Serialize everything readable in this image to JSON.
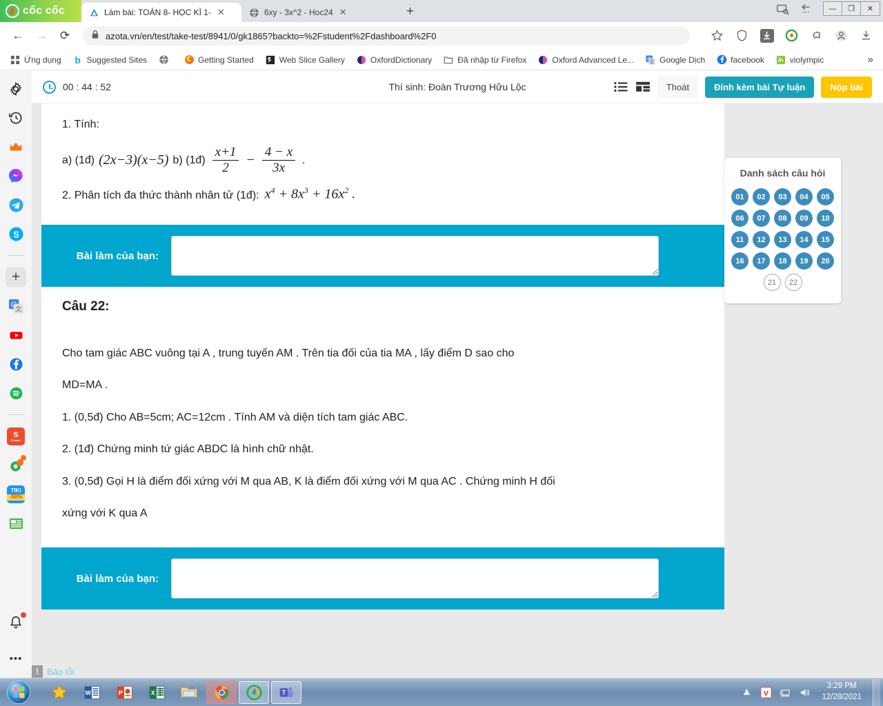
{
  "browser": {
    "brand": "cốc cốc",
    "tabs": [
      {
        "title": "Làm bài: TOÁN 8- HỌC KÌ 1-",
        "active": true,
        "favicon": "azota-triangle-icon"
      },
      {
        "title": "6xy - 3x^2 - Hoc24",
        "active": false,
        "favicon": "globe-icon"
      }
    ],
    "new_tab_label": "+",
    "url": "azota.vn/en/test/take-test/8941/0/gk1865?backto=%2Fstudent%2Fdashboard%2F0",
    "nav": {
      "back": "←",
      "forward": "→",
      "reload": "⟳",
      "lock": "lock-icon"
    },
    "toolbar_icons": [
      "bookmark-star-icon",
      "shield-icon",
      "download-arrow-icon",
      "coccoc-logo-icon",
      "extensions-puzzle-icon",
      "profile-icon",
      "downloads-tray-icon"
    ],
    "window_buttons": {
      "minimize": "—",
      "maximize": "❐",
      "close": "✕"
    },
    "bookmarks": [
      {
        "label": "Ứng dụng",
        "icon": "apps-grid-icon"
      },
      {
        "label": "Suggested Sites",
        "icon": "bing-b-icon"
      },
      {
        "label": "",
        "icon": "globe-icon"
      },
      {
        "label": "Getting Started",
        "icon": "firefox-icon"
      },
      {
        "label": "Web Slice Gallery",
        "icon": "webslice-icon"
      },
      {
        "label": "OxfordDictionary",
        "icon": "oxford-icon"
      },
      {
        "label": "Đã nhập từ Firefox",
        "icon": "folder-icon"
      },
      {
        "label": "Oxford Advanced Le...",
        "icon": "oxford-icon"
      },
      {
        "label": "Google Dịch",
        "icon": "google-translate-icon"
      },
      {
        "label": "facebook",
        "icon": "facebook-icon"
      },
      {
        "label": "violympic",
        "icon": "violympic-icon"
      }
    ],
    "bookmarks_overflow": "»"
  },
  "sidebar": {
    "items": [
      {
        "name": "settings-gear",
        "glyph": "⚙"
      },
      {
        "name": "history-clock",
        "glyph": "↺"
      },
      {
        "name": "crown-premium",
        "glyph": "♛"
      },
      {
        "name": "messenger",
        "glyph": "⚡"
      },
      {
        "name": "telegram",
        "glyph": "➤"
      },
      {
        "name": "skype",
        "glyph": "S"
      },
      {
        "name": "add-new",
        "glyph": "+"
      },
      {
        "name": "google-translate",
        "glyph": "G"
      },
      {
        "name": "youtube",
        "glyph": "▶"
      },
      {
        "name": "facebook",
        "glyph": "f"
      },
      {
        "name": "spotify",
        "glyph": "♫"
      },
      {
        "name": "shopee",
        "glyph": "S"
      },
      {
        "name": "coccoc-game",
        "glyph": "◉"
      },
      {
        "name": "tiki",
        "glyph": "-50%"
      },
      {
        "name": "news",
        "glyph": "▤"
      },
      {
        "name": "notifications-bell",
        "glyph": "🔔"
      },
      {
        "name": "more-options",
        "glyph": "•••"
      }
    ]
  },
  "exam": {
    "timer": "00 : 44 : 52",
    "candidate": "Thí sinh: Đoàn Trương Hữu Lộc",
    "buttons": {
      "exit": "Thoát",
      "attach": "Đính kèm bài Tự luận",
      "submit": "Nộp bài"
    },
    "view_icons": [
      "list-view-icon",
      "grid-view-icon"
    ],
    "question_list": {
      "title": "Danh sách câu hỏi",
      "answered": [
        "01",
        "02",
        "03",
        "04",
        "05",
        "06",
        "07",
        "08",
        "09",
        "10",
        "11",
        "12",
        "13",
        "14",
        "15",
        "16",
        "17",
        "18",
        "19",
        "20"
      ],
      "unanswered": [
        "21",
        "22"
      ]
    },
    "answer_label": "Bài làm của bạn:",
    "answer_value_1": "",
    "answer_value_2": "",
    "report_error": "Báo lỗi",
    "question_21": {
      "line1": "1. Tính:",
      "part_a_prefix": "a) (1đ)",
      "part_a_expr": "(2x−3)(x−5)",
      "part_b_prefix": "b) (1đ)",
      "frac1_num": "x+1",
      "frac1_den": "2",
      "minus": "−",
      "frac2_num": "4 − x",
      "frac2_den": "3x",
      "period": ".",
      "line2_prefix": "2. Phân tích đa thức thành nhân tử (1đ):",
      "line2_expr_base1": "x",
      "line2_sup1": "4",
      "line2_mid1": " + 8x",
      "line2_sup2": "3",
      "line2_mid2": " + 16x",
      "line2_sup3": "2",
      "line2_tail": " ."
    },
    "question_22": {
      "title": "Câu 22:",
      "body": [
        "Cho tam giác ABC vuông tại A , trung tuyến AM . Trên tia đối của tia MA , lấy điểm D sao cho",
        "MD=MA .",
        "1. (0,5đ) Cho AB=5cm; AC=12cm . Tính AM và diện tích tam giác ABC.",
        "2. (1đ) Chứng minh tứ giác ABDC là hình chữ nhật.",
        "3. (0,5đ) Gọi H là điểm đối xứng với M qua AB, K là điểm đối xứng với M qua AC . Chứng minh H đối",
        "xứng với K qua A"
      ]
    }
  },
  "taskbar": {
    "apps": [
      {
        "name": "star-favorites",
        "glyph": "★"
      },
      {
        "name": "microsoft-word",
        "glyph": "W"
      },
      {
        "name": "microsoft-powerpoint",
        "glyph": "P"
      },
      {
        "name": "microsoft-excel",
        "glyph": "X"
      },
      {
        "name": "file-explorer",
        "glyph": "🗀"
      },
      {
        "name": "google-chrome",
        "glyph": "◉"
      },
      {
        "name": "coccoc-browser",
        "glyph": "◔"
      },
      {
        "name": "microsoft-teams",
        "glyph": "T"
      }
    ],
    "tray": [
      "show-hidden-icons",
      "v-app-icon",
      "network-icon",
      "volume-icon"
    ],
    "time": "3:29 PM",
    "date": "12/28/2021"
  },
  "colors": {
    "teal": "#00a6ce",
    "attach_button": "#19a3b8",
    "submit_button": "#fdc600",
    "question_circle": "#3d8dbc"
  }
}
